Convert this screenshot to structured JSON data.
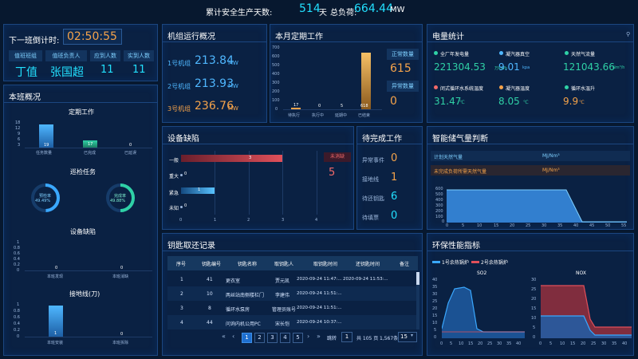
{
  "header": {
    "safe_days_label": "累计安全生产天数:",
    "safe_days_value": "514",
    "safe_days_unit": "天",
    "load_label": "总负荷:",
    "load_value": "664.44",
    "load_unit": "MW"
  },
  "shift": {
    "countdown_label": "下一班倒计时:",
    "countdown_value": "02:50:55",
    "headers": [
      "值班班组",
      "值班负责人",
      "应到人数",
      "实到人数"
    ],
    "values": [
      "丁值",
      "张国超",
      "11",
      "11"
    ]
  },
  "overview": {
    "title": "本班概况",
    "task": {
      "title": "定期工作",
      "yticks": [
        "18",
        "12",
        "9",
        "6",
        "3"
      ],
      "bars": [
        {
          "label": "任务数量",
          "value": 19,
          "color": "#4fb7ff"
        },
        {
          "label": "已完成",
          "value": 17,
          "color": "#2fd1a6"
        },
        {
          "label": "已延误",
          "value": 0,
          "color": "#f4a64a"
        }
      ]
    },
    "inspect": {
      "title": "巡检任务",
      "planned_label": "预检率",
      "planned_value": "49.49%",
      "done_label": "完成率",
      "done_value": "49.88%"
    },
    "defect": {
      "title": "设备缺陷",
      "yticks": [
        "1",
        "0.8",
        "0.6",
        "0.4",
        "0.2",
        "0"
      ],
      "bars": [
        {
          "label": "本班发现",
          "value": 0
        },
        {
          "label": "本班消缺",
          "value": 0
        }
      ]
    },
    "ground": {
      "title": "接地线(刀)",
      "yticks": [
        "1",
        "0.8",
        "0.6",
        "0.4",
        "0.2",
        "0"
      ],
      "bars": [
        {
          "label": "本班安装",
          "value": 1
        },
        {
          "label": "本班拆除",
          "value": 0
        }
      ]
    }
  },
  "units": {
    "title": "机组运行概况",
    "items": [
      {
        "label": "1号机组",
        "value": "213.84",
        "unit": "MW"
      },
      {
        "label": "2号机组",
        "value": "213.93",
        "unit": "MW"
      },
      {
        "label": "3号机组",
        "value": "236.76",
        "unit": "MW"
      }
    ]
  },
  "monthly": {
    "title": "本月定期工作",
    "yticks": [
      "700",
      "600",
      "500",
      "400",
      "300",
      "200",
      "100",
      "0"
    ],
    "bars": [
      {
        "label": "待执行",
        "value": 17
      },
      {
        "label": "执行中",
        "value": 0
      },
      {
        "label": "延期中",
        "value": 5
      },
      {
        "label": "已结束",
        "value": 618
      }
    ],
    "normal_label": "正常数量",
    "normal_value": "615",
    "abnormal_label": "异常数量",
    "abnormal_value": "0"
  },
  "power": {
    "title": "电量统计",
    "items": [
      {
        "label": "全厂年发电量",
        "value": "221304.53",
        "unit": "万kWh",
        "color": "#2fd1a6"
      },
      {
        "label": "凝汽器真空",
        "value": "9.01",
        "unit": "kpa",
        "color": "#4fb7ff"
      },
      {
        "label": "天然气流量",
        "value": "121043.66",
        "unit": "Nm³/h",
        "color": "#2fd1a6"
      },
      {
        "label": "闭式循环水系统温度",
        "value": "31.47",
        "unit": "℃",
        "color": "#f26a6a"
      },
      {
        "label": "凝汽器温度",
        "value": "8.05",
        "unit": "℃",
        "color": "#f5a34a"
      },
      {
        "label": "循环水温升",
        "value": "9.9",
        "unit": "℃",
        "color": "#2fd1a6"
      }
    ]
  },
  "defects": {
    "title": "设备缺陷",
    "rows": [
      {
        "label": "一般",
        "value": 3,
        "color": "#e0505a"
      },
      {
        "label": "重大",
        "value": 0,
        "color": "#e0505a"
      },
      {
        "label": "紧急",
        "value": 1,
        "color": "#58c2ff"
      },
      {
        "label": "未知",
        "value": 0,
        "color": "#58c2ff"
      }
    ],
    "xticks": [
      "0",
      "1",
      "2",
      "3",
      "4"
    ],
    "unresolved_label": "未消缺",
    "unresolved_value": "5"
  },
  "pending": {
    "title": "待完成工作",
    "items": [
      {
        "label": "异常事件",
        "value": "0",
        "color": "#f5a34a"
      },
      {
        "label": "接地线",
        "value": "1",
        "color": "#f5a34a"
      },
      {
        "label": "待还钥匙",
        "value": "6",
        "color": "#22e0ff"
      },
      {
        "label": "待填票",
        "value": "0",
        "color": "#22e0ff"
      }
    ]
  },
  "gas": {
    "title": "智能储气量判断",
    "plan_label": "计划天然气量",
    "plan_unit": "MJ/Nm³",
    "forecast_label": "未完成负荷所需天然气量",
    "forecast_unit": "MJ/Nm³",
    "yticks": [
      "600",
      "500",
      "400",
      "300",
      "200",
      "100",
      "0"
    ],
    "xticks": [
      "0",
      "5",
      "10",
      "15",
      "20",
      "25",
      "30",
      "35",
      "40",
      "45",
      "50",
      "55"
    ]
  },
  "keys": {
    "title": "钥匙取还记录",
    "columns": [
      "序号",
      "钥匙编号",
      "钥匙名称",
      "取钥匙人",
      "取钥匙时间",
      "还钥匙时间",
      "备注"
    ],
    "rows": [
      [
        "1",
        "41",
        "更衣室",
        "贾元凯",
        "2020-09-24 11:47:...",
        "2020-09-24 11:53:...",
        ""
      ],
      [
        "2",
        "10",
        "两丝站南侧楼栏门",
        "李建伟",
        "2020-09-24 11:51:...",
        "",
        ""
      ],
      [
        "3",
        "8",
        "循环水泵房",
        "管理员账号",
        "2020-09-24 11:51:...",
        "",
        ""
      ],
      [
        "4",
        "44",
        "问询内机公用PC",
        "宋长恺",
        "2020-09-24 10:37:...",
        "",
        ""
      ]
    ],
    "pager": {
      "pages": [
        "1",
        "2",
        "3",
        "4",
        "5"
      ],
      "goto_label": "跳转",
      "goto_value": "1",
      "total_label": "共 105 页",
      "total_count": "1,567条",
      "page_size": "15"
    }
  },
  "env": {
    "title": "环保性能指标",
    "legend": [
      {
        "label": "1号余热锅炉",
        "color": "#3aa8ff"
      },
      {
        "label": "2号余热锅炉",
        "color": "#e0505a"
      }
    ],
    "so2": {
      "title": "SO2",
      "yticks": [
        "40",
        "35",
        "30",
        "25",
        "20",
        "15",
        "10",
        "5",
        "0"
      ],
      "xticks": [
        "0",
        "5",
        "10",
        "15",
        "20",
        "25",
        "30",
        "35",
        "40"
      ]
    },
    "nox": {
      "title": "NOX",
      "yticks": [
        "30",
        "25",
        "20",
        "15",
        "10",
        "5",
        "0"
      ],
      "xticks": [
        "0",
        "5",
        "10",
        "15",
        "20",
        "25",
        "30",
        "35",
        "40"
      ]
    }
  },
  "colors": {
    "accent": "#22e0ff",
    "orange": "#f5a34a",
    "red": "#e0505a",
    "panel_bg": "#0a2143",
    "page_bg": "#07182f"
  }
}
